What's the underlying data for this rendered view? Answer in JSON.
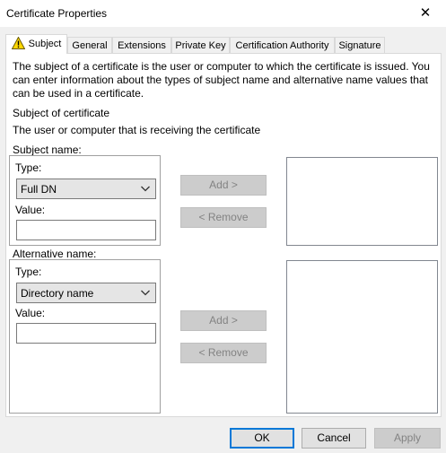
{
  "window": {
    "title": "Certificate Properties",
    "close_glyph": "✕"
  },
  "tabs": [
    {
      "label": "Subject",
      "icon": "warning-icon"
    },
    {
      "label": "General"
    },
    {
      "label": "Extensions"
    },
    {
      "label": "Private Key"
    },
    {
      "label": "Certification Authority"
    },
    {
      "label": "Signature"
    }
  ],
  "subject": {
    "intro": [
      "The subject of a certificate is the user or computer to which the certificate is issued. You",
      "can enter information about the types of subject name and alternative name values that",
      "can be used in a certificate."
    ],
    "section_title": "Subject of certificate",
    "section_desc": "The user or computer that is receiving the certificate",
    "subject_name": {
      "label": "Subject name:",
      "type_label": "Type:",
      "type_value": "Full DN",
      "value_label": "Value:",
      "value": ""
    },
    "alternative_name": {
      "label": "Alternative name:",
      "type_label": "Type:",
      "type_value": "Directory name",
      "value_label": "Value:",
      "value": ""
    },
    "add_label": "Add >",
    "remove_label": "< Remove"
  },
  "footer": {
    "ok": "OK",
    "cancel": "Cancel",
    "apply": "Apply"
  },
  "colors": {
    "accent": "#0078d7",
    "warning": "#ffd800"
  }
}
